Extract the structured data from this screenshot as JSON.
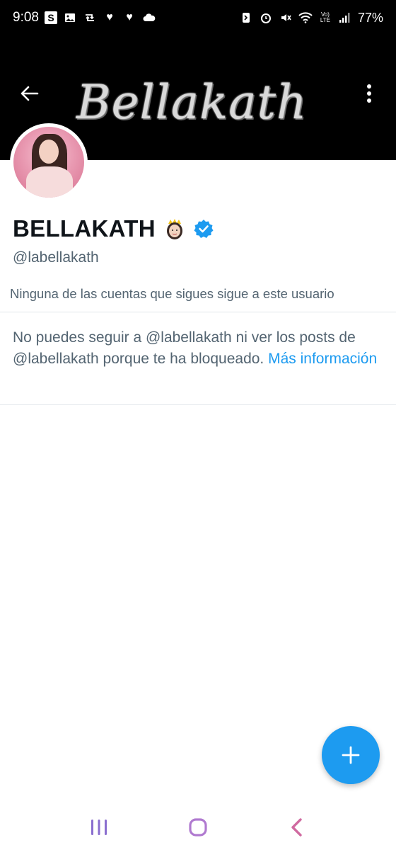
{
  "status_bar": {
    "time": "9:08",
    "battery": "77%",
    "network": "LTE",
    "left_icons": [
      "s-app-icon",
      "gallery-icon",
      "retweet-icon",
      "heart-icon",
      "heart-icon",
      "cloud-icon"
    ],
    "right_icons": [
      "nfc-icon",
      "alarm-icon",
      "mute-icon",
      "wifi-icon",
      "volte-icon",
      "signal-icon"
    ]
  },
  "header": {
    "banner_text": "Bellakath"
  },
  "profile": {
    "display_name": "BELLAKATH",
    "handle": "@labellakath",
    "verified_color": "#1d9bf0",
    "followers_note": "Ninguna de las cuentas que sigues sigue a este usuario"
  },
  "blocked": {
    "message": "No puedes seguir a @labellakath ni ver los posts de @labellakath porque te ha bloqueado. ",
    "link_label": "Más información"
  },
  "colors": {
    "accent": "#1d9bf0",
    "text_primary": "#0f1419",
    "text_secondary": "#536471"
  }
}
